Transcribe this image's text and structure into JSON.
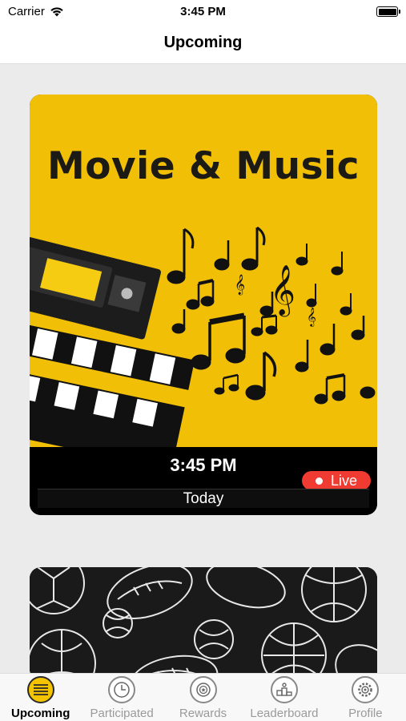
{
  "status_bar": {
    "carrier": "Carrier",
    "time": "3:45 PM"
  },
  "nav": {
    "title": "Upcoming"
  },
  "events": [
    {
      "title": "Movie & Music",
      "time": "3:45 PM",
      "day": "Today",
      "live_label": "Live",
      "accent_color": "#f0bf06",
      "badge_color": "#f03b32"
    },
    {
      "image": "sports-balls-pattern"
    }
  ],
  "tabs": [
    {
      "label": "Upcoming",
      "icon": "list-icon",
      "active": true
    },
    {
      "label": "Participated",
      "icon": "clock-icon",
      "active": false
    },
    {
      "label": "Rewards",
      "icon": "medal-icon",
      "active": false
    },
    {
      "label": "Leaderboard",
      "icon": "podium-icon",
      "active": false
    },
    {
      "label": "Profile",
      "icon": "gear-icon",
      "active": false
    }
  ]
}
